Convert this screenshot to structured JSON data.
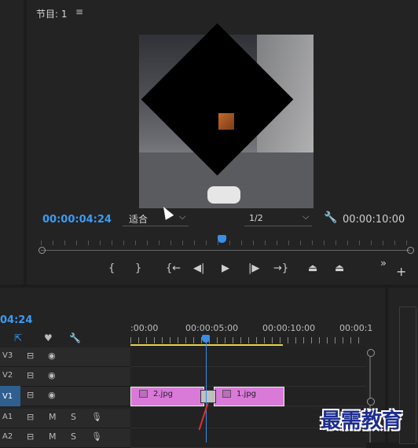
{
  "program_monitor": {
    "title": "节目: 1",
    "menu_icon": "≡",
    "current_timecode": "00:00:04:24",
    "fit_value": "适合",
    "resolution_value": "1/2",
    "duration_timecode": "00:00:10:00",
    "playhead_fraction": 0.5,
    "controls": {
      "mark_in": "{",
      "mark_out": "}",
      "go_to_in": "{←",
      "step_back": "◀|",
      "play": "▶",
      "step_forward": "|▶",
      "go_to_out": "→}",
      "lift": "⏏",
      "extract": "⏏",
      "more": "»",
      "add": "+"
    }
  },
  "timeline": {
    "current_timecode": "04:24",
    "ruler_labels": [
      ":00:00",
      "00:00:05:00",
      "00:00:10:00",
      "00:00:1"
    ],
    "tracks": [
      {
        "name": "V3"
      },
      {
        "name": "V2"
      },
      {
        "name": "V1"
      },
      {
        "name": "A1",
        "m": "M",
        "s": "S"
      },
      {
        "name": "A2",
        "m": "M",
        "s": "S"
      }
    ],
    "clips": [
      {
        "name": "2.jpg",
        "color": "#d97ad9"
      },
      {
        "name": "1.jpg",
        "color": "#d97ad9"
      }
    ]
  },
  "watermark": "最需教育",
  "colors": {
    "accent": "#3a9bf3",
    "clip": "#d97ad9",
    "work_area": "#e6d24a"
  }
}
